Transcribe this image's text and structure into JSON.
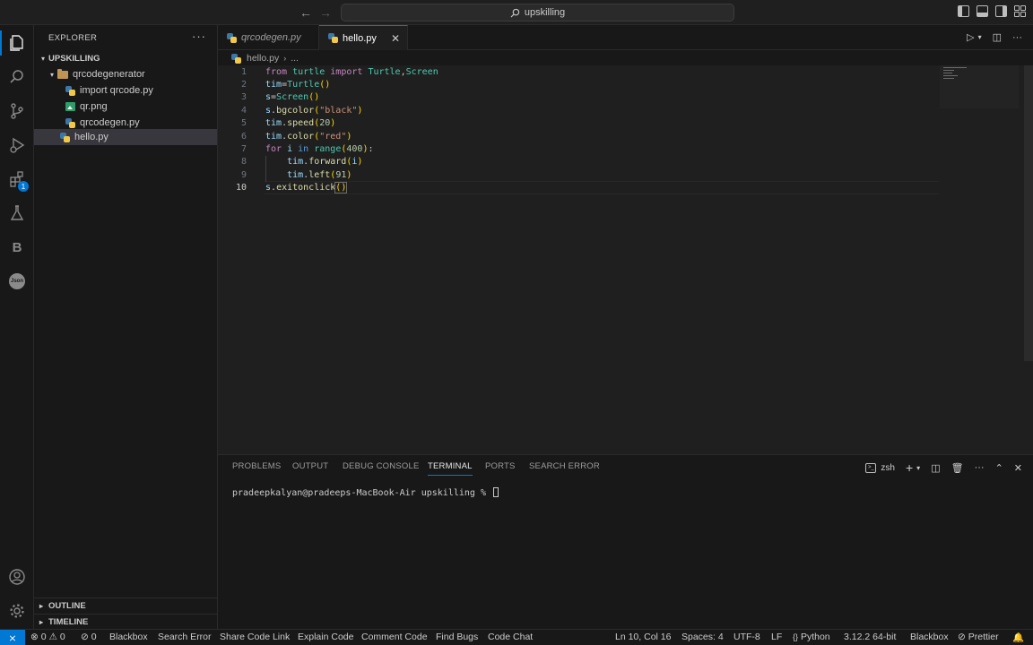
{
  "titlebar": {
    "search_text": "upskilling"
  },
  "activity": {
    "extensions_badge": "1",
    "b_label": "B",
    "json_label": "Json"
  },
  "sidebar": {
    "title": "EXPLORER",
    "workspace": "UPSKILLING",
    "folder": "qrcodegenerator",
    "files": [
      "import qrcode.py",
      "qr.png",
      "qrcodegen.py"
    ],
    "root_file": "hello.py",
    "outline": "OUTLINE",
    "timeline": "TIMELINE"
  },
  "tabs": [
    {
      "label": "qrcodegen.py"
    },
    {
      "label": "hello.py"
    }
  ],
  "breadcrumb": {
    "file": "hello.py",
    "rest": "..."
  },
  "editor": {
    "line_numbers": [
      "1",
      "2",
      "3",
      "4",
      "5",
      "6",
      "7",
      "8",
      "9",
      "10"
    ],
    "lines": [
      "from turtle import Turtle,Screen",
      "tim=Turtle()",
      "s=Screen()",
      "s.bgcolor(\"black\")",
      "tim.speed(20)",
      "tim.color(\"red\")",
      "for i in range(400):",
      "    tim.forward(i)",
      "    tim.left(91)",
      "s.exitonclick()"
    ]
  },
  "panel": {
    "tabs": [
      "PROBLEMS",
      "OUTPUT",
      "DEBUG CONSOLE",
      "TERMINAL",
      "PORTS",
      "SEARCH ERROR"
    ],
    "active_tab": "TERMINAL",
    "shell": "zsh",
    "prompt": "pradeepkalyan@pradeeps-MacBook-Air upskilling % "
  },
  "statusbar": {
    "errors": "0",
    "warnings": "0",
    "ports": "0",
    "left_items": [
      "Blackbox",
      "Search Error",
      "Share Code Link",
      "Explain Code",
      "Comment Code",
      "Find Bugs",
      "Code Chat"
    ],
    "position": "Ln 10, Col 16",
    "spaces": "Spaces: 4",
    "encoding": "UTF-8",
    "eol": "LF",
    "language": "Python",
    "interpreter": "3.12.2 64-bit",
    "blackbox": "Blackbox",
    "prettier": "Prettier"
  },
  "colors": {
    "accent": "#0078d4",
    "editor_bg": "#1f1f1f",
    "sidebar_bg": "#181818"
  }
}
